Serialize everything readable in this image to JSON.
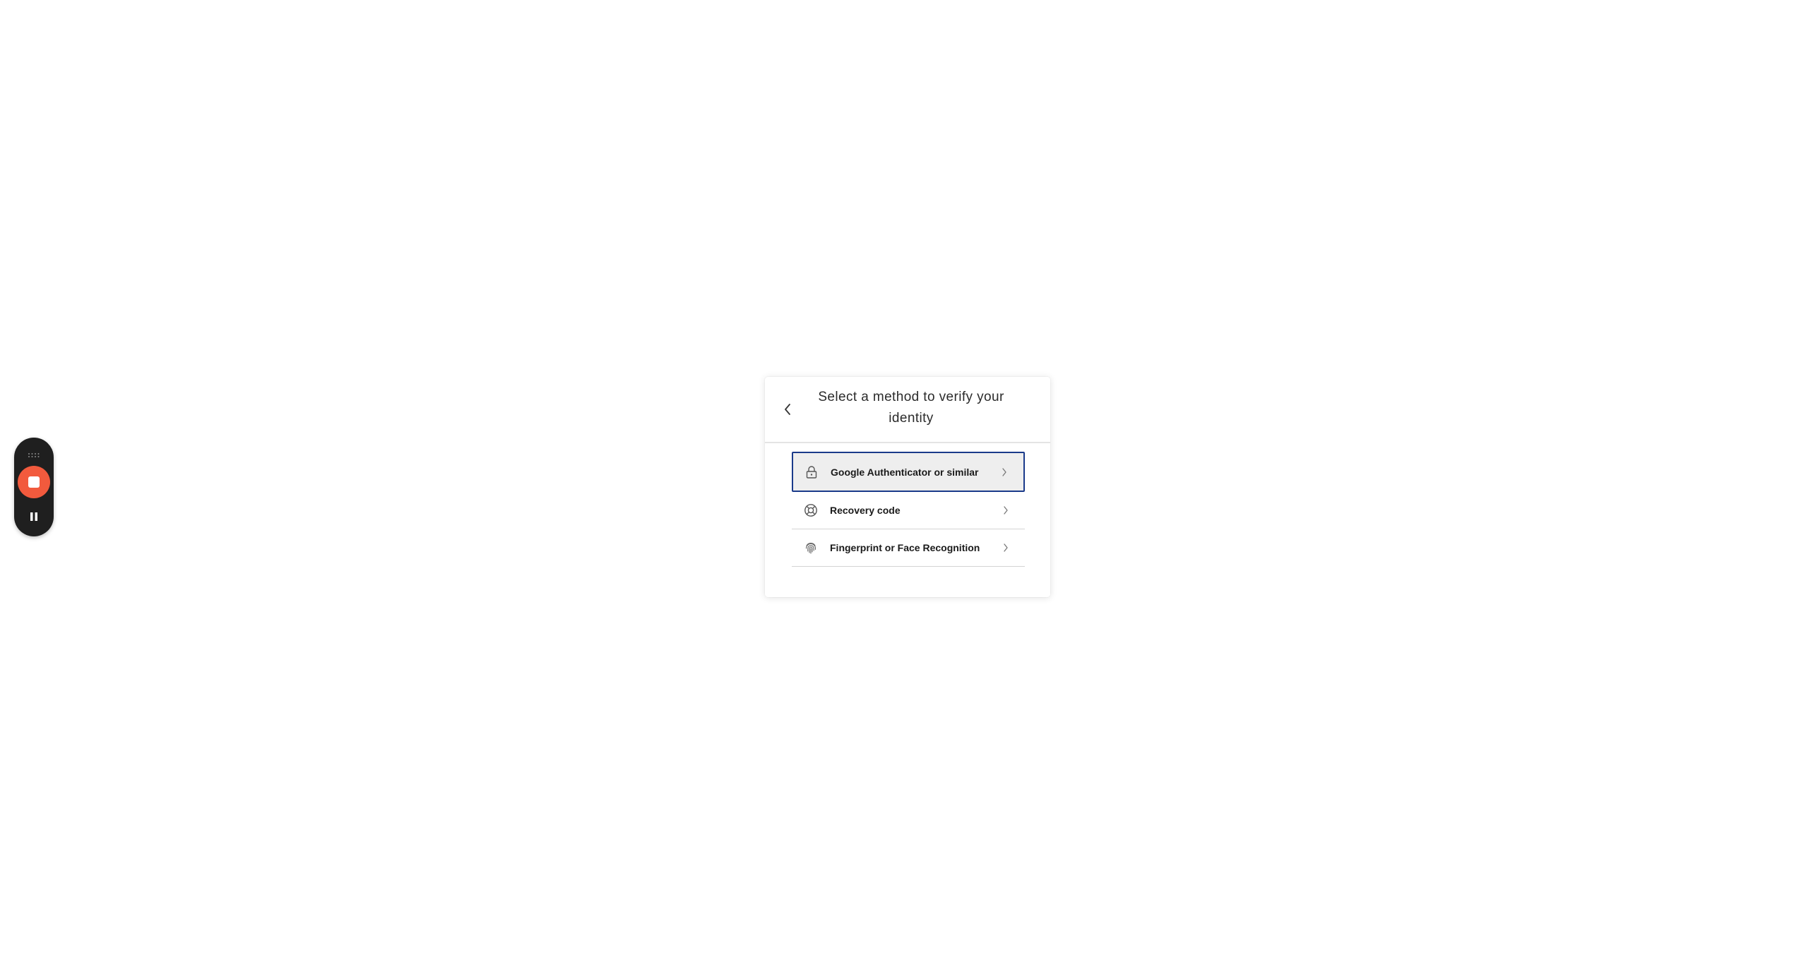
{
  "recorder": {
    "grip_icon": "drag-dots-icon",
    "stop_icon": "stop-icon",
    "pause_icon": "pause-icon",
    "stop_color": "#f25a3d",
    "background": "#1f1f1f"
  },
  "dialog": {
    "back_icon": "chevron-left-icon",
    "title": "Select a method to verify your identity",
    "methods": [
      {
        "label": "Google Authenticator or similar",
        "icon": "lock-icon",
        "selected": true
      },
      {
        "label": "Recovery code",
        "icon": "lifebuoy-icon",
        "selected": false
      },
      {
        "label": "Fingerprint or Face Recognition",
        "icon": "fingerprint-icon",
        "selected": false
      }
    ],
    "selected_border_color": "#1a3a8a"
  }
}
